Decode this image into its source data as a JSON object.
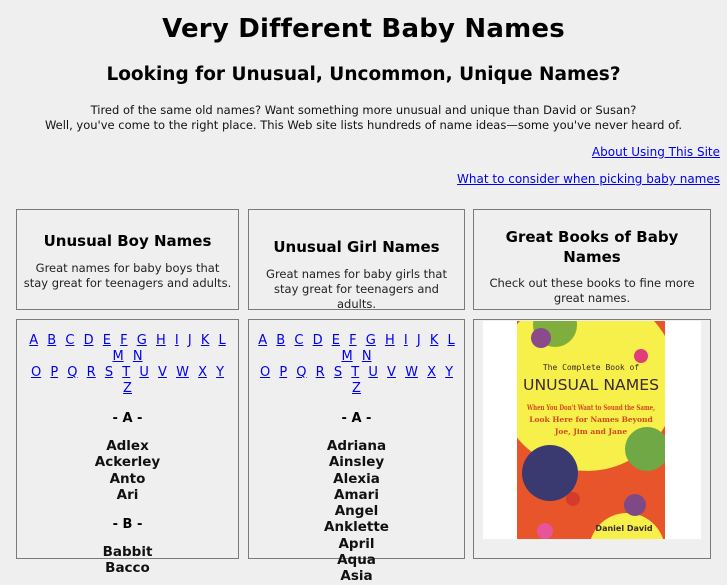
{
  "header": {
    "title": "Very Different Baby Names",
    "subtitle": "Looking for Unusual, Uncommon, Unique Names?",
    "intro_line1": "Tired of the same old names? Want something more unusual and unique than David or Susan?",
    "intro_line2": "Well, you've come to the right place. This Web site lists hundreds of name ideas—some you've never heard of."
  },
  "links": {
    "about": "About Using This Site",
    "consider": "What to consider when picking baby names"
  },
  "columns": {
    "boys": {
      "heading": "Unusual Boy Names",
      "description": "Great names for baby boys that stay great for teenagers and adults.",
      "sections": [
        {
          "letter": "- A -",
          "names": [
            "Adlex",
            "Ackerley",
            "Anto",
            "Ari"
          ]
        },
        {
          "letter": "- B -",
          "names": [
            "Babbit",
            "Bacco"
          ]
        }
      ]
    },
    "girls": {
      "heading": "Unusual Girl Names",
      "description": "Great names for baby girls that stay great for teenagers and adults.",
      "sections": [
        {
          "letter": "- A -",
          "names": [
            "Adriana",
            "Ainsley",
            "Alexia",
            "Amari",
            "Angel",
            "Anklette",
            "April",
            "Aqua",
            "Asia"
          ]
        }
      ]
    },
    "books": {
      "heading": "Great Books of Baby Names",
      "description": "Check out these books to fine more great names.",
      "book": {
        "pre_title": "The Complete Book of",
        "title": "UNUSUAL NAMES",
        "tagline1": "When You Don't Want to Sound the Same,",
        "tagline2": "Look Here for Names Beyond",
        "tagline3": "Joe, Jim and Jane",
        "author": "Daniel David"
      }
    }
  },
  "alphabet_row1": [
    "A",
    "B",
    "C",
    "D",
    "E",
    "F",
    "G",
    "H",
    "I",
    "J",
    "K",
    "L",
    "M",
    "N"
  ],
  "alphabet_row2": [
    "O",
    "P",
    "Q",
    "R",
    "S",
    "T",
    "U",
    "V",
    "W",
    "X",
    "Y",
    "Z"
  ],
  "colors": {
    "link": "#0000ee",
    "background": "#efefef",
    "cover_orange": "#e8552a",
    "cover_yellow": "#f7ef4a"
  }
}
